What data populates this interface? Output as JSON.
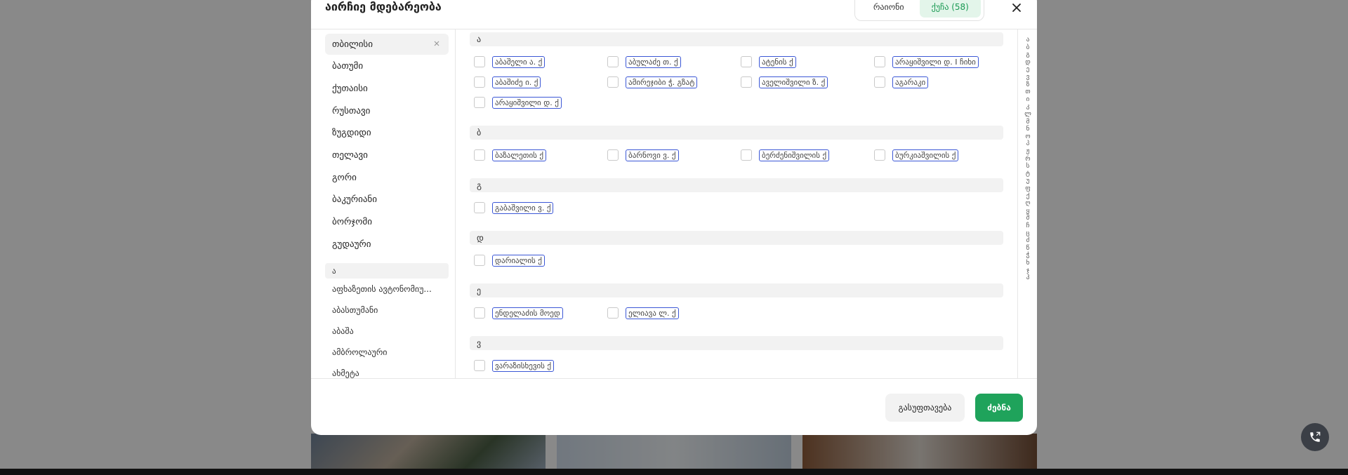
{
  "modal": {
    "title": "აირჩიე მდებარეობა",
    "tabs": [
      {
        "label": "რაიონი"
      },
      {
        "label": "ქუჩა (58)"
      }
    ],
    "footer": {
      "clear_label": "გასუფთავება",
      "search_label": "ძებნა"
    }
  },
  "cities": [
    "თბილისი",
    "ბათუმი",
    "ქუთაისი",
    "რუსთავი",
    "ზუგდიდი",
    "თელავი",
    "გორი",
    "ბაკურიანი",
    "ბორჯომი",
    "გუდაური"
  ],
  "regions": {
    "letter": "ა",
    "items": [
      "აფხაზეთის ავტონომიუ...",
      "აბასთუმანი",
      "აბაშა",
      "ამბროლაური",
      "ახმეტა"
    ]
  },
  "street_sections": [
    {
      "letter": "ა",
      "streets": [
        "აბაშელი ა. ქ",
        "აბულაძე თ. ქ",
        "ატენის ქ",
        "არაყიშვილი დ. I ჩიხი",
        "აბაშიძე ი. ქ",
        "ამირეჯიბი ჭ. გზატ",
        "აველიშვილი ზ. ქ",
        "აგარაკი",
        "არაყიშვილი დ. ქ"
      ]
    },
    {
      "letter": "ბ",
      "streets": [
        "ბაზალეთის ქ",
        "ბარნოვი ვ. ქ",
        "ბერძენიშვილის ქ",
        "ბურკიაშვილის ქ"
      ]
    },
    {
      "letter": "გ",
      "streets": [
        "გაბაშვილი ვ. ქ"
      ]
    },
    {
      "letter": "დ",
      "streets": [
        "დარიალის ქ"
      ]
    },
    {
      "letter": "ე",
      "streets": [
        "ენდელაძის მოედ",
        "ელიავა ლ. ქ"
      ]
    },
    {
      "letter": "ვ",
      "streets": [
        "ვარაზისხევის ქ"
      ]
    }
  ],
  "alphabet": [
    "ა",
    "ბ",
    "გ",
    "დ",
    "ე",
    "ვ",
    "ზ",
    "თ",
    "ი",
    "კ",
    "ლ",
    "მ",
    "ნ",
    "ო",
    "პ",
    "ჟ",
    "რ",
    "ს",
    "ტ",
    "უ",
    "ფ",
    "ქ",
    "ღ",
    "ყ",
    "შ",
    "ჩ",
    "ც",
    "ძ",
    "წ",
    "ჭ",
    "ხ",
    "ჯ",
    "ჰ"
  ],
  "colors": {
    "accent": "#1fa35b",
    "accent_bg": "#e3f5ea",
    "tag_border": "#3b57d6"
  }
}
